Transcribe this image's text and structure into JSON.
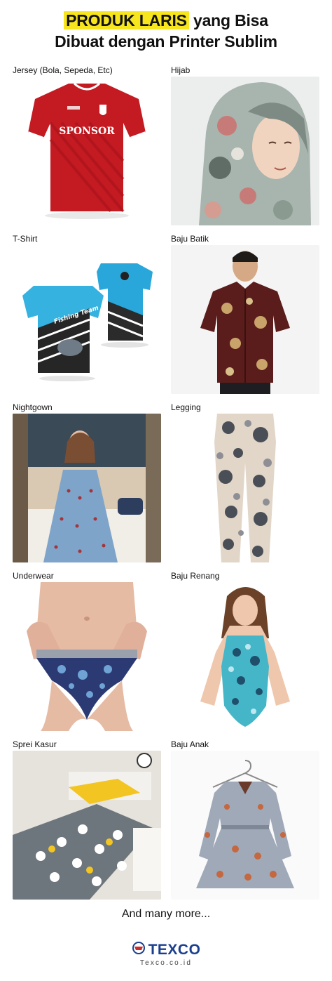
{
  "header": {
    "highlight": "PRODUK LARIS",
    "line1_rest": "yang Bisa",
    "line2": "Dibuat dengan Printer Sublim"
  },
  "products": [
    {
      "label": "Jersey (Bola, Sepeda, Etc)",
      "print_text": "SPONSOR",
      "icon": "jersey-image"
    },
    {
      "label": "Hijab",
      "icon": "hijab-image"
    },
    {
      "label": "T-Shirt",
      "print_text": "Fishing Team",
      "icon": "tshirt-image"
    },
    {
      "label": "Baju Batik",
      "icon": "batik-image"
    },
    {
      "label": "Nightgown",
      "icon": "nightgown-image"
    },
    {
      "label": "Legging",
      "icon": "legging-image"
    },
    {
      "label": "Underwear",
      "icon": "underwear-image"
    },
    {
      "label": "Baju Renang",
      "icon": "swimsuit-image"
    },
    {
      "label": "Sprei Kasur",
      "icon": "bedsheet-image"
    },
    {
      "label": "Baju Anak",
      "icon": "kids-dress-image"
    }
  ],
  "footer": {
    "more": "And many more...",
    "brand": "TEXCO",
    "site": "Texco.co.id",
    "icon": "texco-logo-icon"
  },
  "colors": {
    "highlight": "#f7e51e",
    "brand": "#1b3f8f",
    "brand_red": "#d02a2a"
  }
}
